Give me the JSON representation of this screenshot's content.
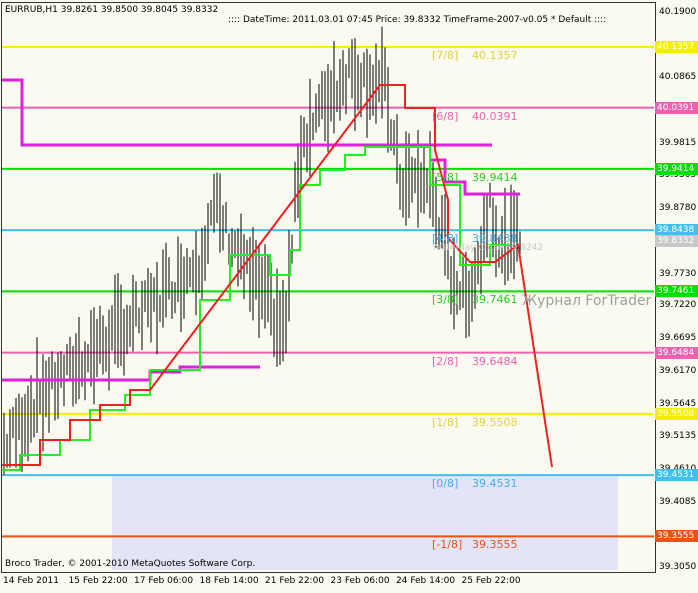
{
  "header": {
    "symbol_info": "EURRUB,H1  39.8261 39.8500 39.8045 39.8332",
    "indicator_info": ":::: DateTime: 2011.03.01 07:45   Price: 39.8332   TimeFrame-2007-v0.05    *  Default  ::::"
  },
  "price_ticks": [
    "40.1900",
    "40.0865",
    "39.9815",
    "39.9305",
    "39.8780",
    "39.7730",
    "39.7220",
    "39.6695",
    "39.6170",
    "39.5645",
    "39.5135",
    "39.4610",
    "39.4085",
    "39.3050"
  ],
  "levels": [
    {
      "label": "[7/8]",
      "value": "40.1357",
      "color": "#f0f000",
      "text_color": "#e0d040"
    },
    {
      "label": "[6/8]",
      "value": "40.0391",
      "color": "#f060b0",
      "text_color": "#f060b0"
    },
    {
      "label": "[5/8]",
      "value": "39.9414",
      "color": "#00e000",
      "text_color": "#20d020"
    },
    {
      "label": "[4/8]",
      "value": "39.8438",
      "color": "#40c0f0",
      "text_color": "#40b0f0"
    },
    {
      "label": "[3/8]",
      "value": "39.7461",
      "color": "#00e000",
      "text_color": "#20d020"
    },
    {
      "label": "[2/8]",
      "value": "39.6484",
      "color": "#f060b0",
      "text_color": "#f060b0"
    },
    {
      "label": "[1/8]",
      "value": "39.5508",
      "color": "#f0f000",
      "text_color": "#e0d040"
    },
    {
      "label": "[0/8]",
      "value": "39.4531",
      "color": "#40c0f0",
      "text_color": "#40b0f0"
    },
    {
      "label": "[-1/8]",
      "value": "39.3555",
      "color": "#f05010",
      "text_color": "#f05010"
    }
  ],
  "current_price_tag": "39.8332",
  "yesterday_close": "Yesterday Close 39.8242",
  "watermark": "Журнал ForTrader",
  "copyright": "Broco Trader, © 2001-2010 MetaQuotes Software Corp.",
  "time_labels": [
    "14 Feb 2011",
    "15 Feb 22:00",
    "17 Feb 06:00",
    "18 Feb 14:00",
    "21 Feb 22:00",
    "23 Feb 06:00",
    "24 Feb 14:00",
    "25 Feb 22:00"
  ],
  "price_path": [
    [
      5,
      39.5
    ],
    [
      40,
      39.58
    ],
    [
      100,
      39.66
    ],
    [
      150,
      39.72
    ],
    [
      200,
      39.8
    ],
    [
      215,
      39.88
    ],
    [
      240,
      39.8
    ],
    [
      270,
      39.72
    ],
    [
      285,
      39.68
    ],
    [
      300,
      39.98
    ],
    [
      330,
      40.06
    ],
    [
      350,
      40.1
    ],
    [
      385,
      40.07
    ],
    [
      400,
      39.92
    ],
    [
      430,
      39.92
    ],
    [
      450,
      39.78
    ],
    [
      465,
      39.73
    ],
    [
      480,
      39.8
    ],
    [
      490,
      39.9
    ],
    [
      500,
      39.81
    ],
    [
      520,
      39.83
    ]
  ]
}
